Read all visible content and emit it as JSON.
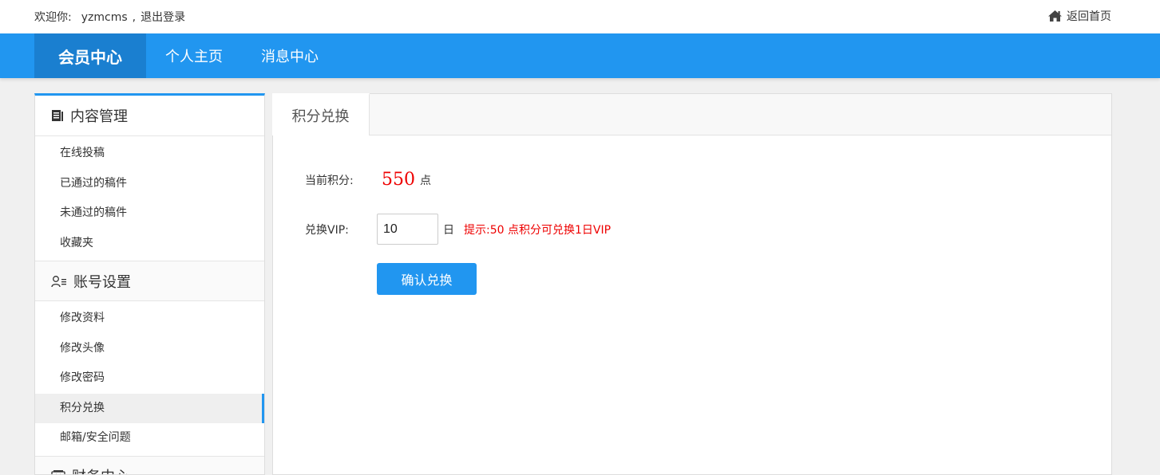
{
  "topbar": {
    "welcome_label": "欢迎你:",
    "username": "yzmcms",
    "separator": ",",
    "logout_label": "退出登录",
    "home_label": "返回首页",
    "home_icon": "home-icon"
  },
  "navbar": {
    "brand": "会员中心",
    "links": [
      "个人主页",
      "消息中心"
    ],
    "color": "#2196f0"
  },
  "sidebar": {
    "sections": [
      {
        "title": "内容管理",
        "icon": "document-icon",
        "items": [
          "在线投稿",
          "已通过的稿件",
          "未通过的稿件",
          "收藏夹"
        ]
      },
      {
        "title": "账号设置",
        "icon": "user-settings-icon",
        "items": [
          "修改资料",
          "修改头像",
          "修改密码",
          "积分兑换",
          "邮箱/安全问题"
        ]
      },
      {
        "title": "财务中心",
        "icon": "wallet-icon",
        "items": []
      }
    ],
    "active_item": "积分兑换"
  },
  "main": {
    "tab": "积分兑换",
    "points_label": "当前积分:",
    "points_value": "550",
    "points_unit": "点",
    "vip_label": "兑换VIP:",
    "vip_days_value": "10",
    "vip_days_unit": "日",
    "hint": "提示:50 点积分可兑换1日VIP",
    "submit_label": "确认兑换"
  }
}
